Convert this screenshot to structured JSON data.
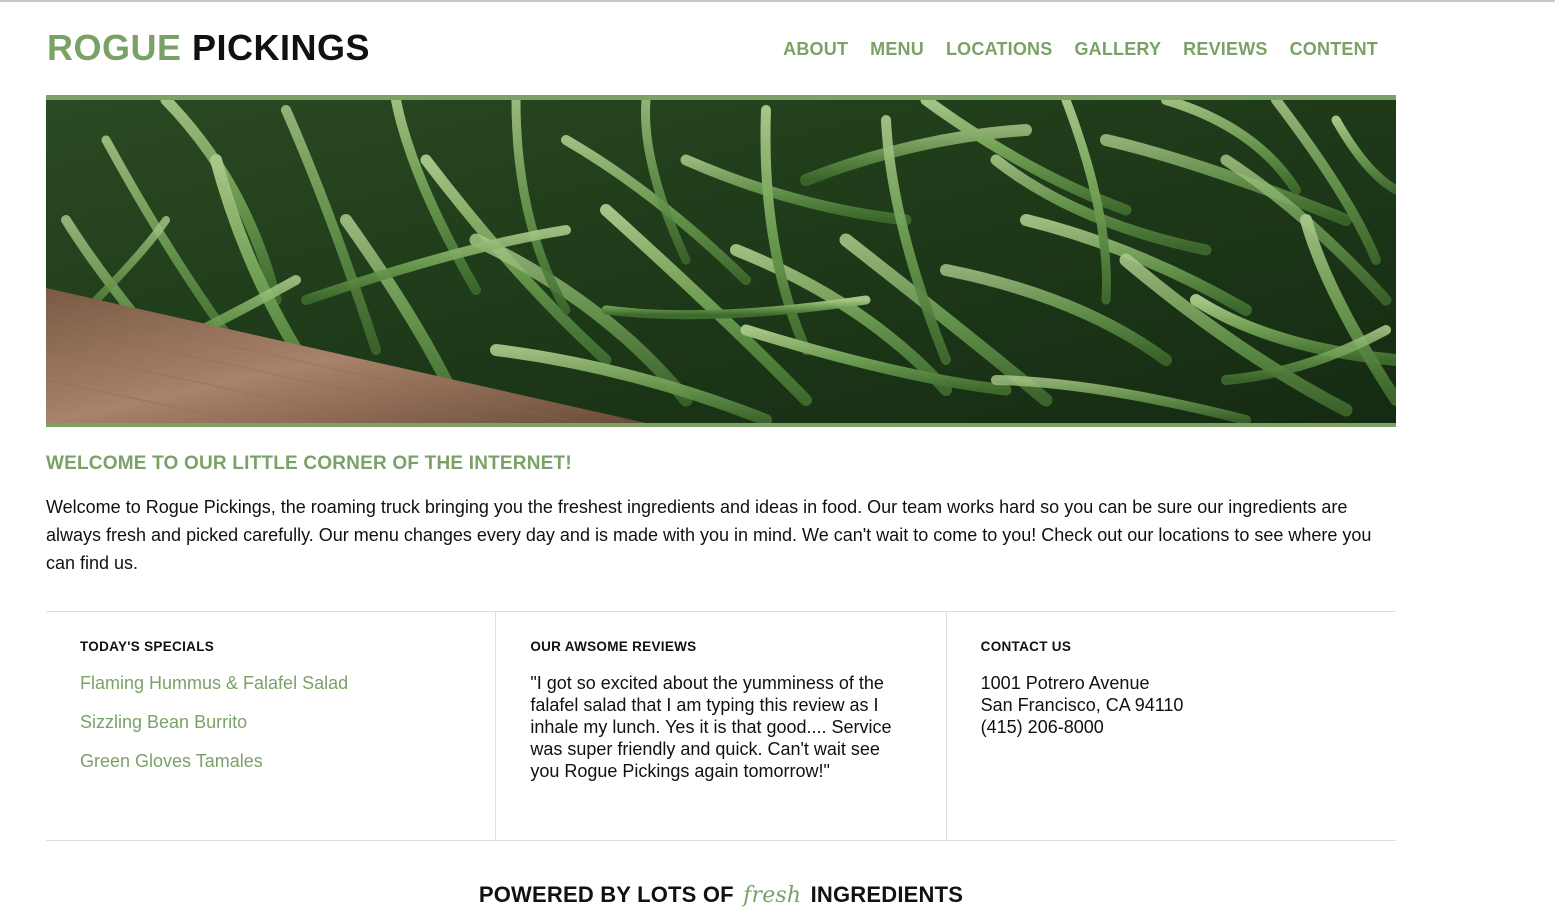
{
  "header": {
    "logo_accent": "ROGUE",
    "logo_main": "PICKINGS",
    "nav": [
      "ABOUT",
      "MENU",
      "LOCATIONS",
      "GALLERY",
      "REVIEWS",
      "CONTENT"
    ]
  },
  "hero": {
    "image_subject": "green beans in a wooden crate"
  },
  "welcome": {
    "title": "WELCOME TO OUR LITTLE CORNER OF THE INTERNET!",
    "text": "Welcome to Rogue Pickings, the roaming truck bringing you the freshest ingredients and ideas in food. Our team works hard so you can be sure our ingredients are always fresh and picked carefully. Our menu changes every day and is made with you in mind. We can't wait to come to you! Check out our locations to see where you can find us."
  },
  "specials": {
    "title": "TODAY'S SPECIALS",
    "items": [
      "Flaming Hummus & Falafel Salad",
      "Sizzling Bean Burrito",
      "Green Gloves Tamales"
    ]
  },
  "reviews": {
    "title": "OUR AWSOME REVIEWS",
    "quote": "\"I got so excited about the yumminess of the falafel salad that I am typing this review as I inhale my lunch. Yes it is that good.... Service was super friendly and quick. Can't wait see you Rogue Pickings again tomorrow!\""
  },
  "contact": {
    "title": "CONTACT US",
    "address_line1": "1001 Potrero Avenue",
    "address_line2": "San Francisco, CA 94110",
    "phone": "(415) 206-8000"
  },
  "footer": {
    "before": "POWERED BY LOTS OF",
    "fresh": "fresh",
    "after": "INGREDIENTS"
  },
  "colors": {
    "accent": "#7aa267",
    "text": "#111111",
    "divider": "#dddddd"
  }
}
